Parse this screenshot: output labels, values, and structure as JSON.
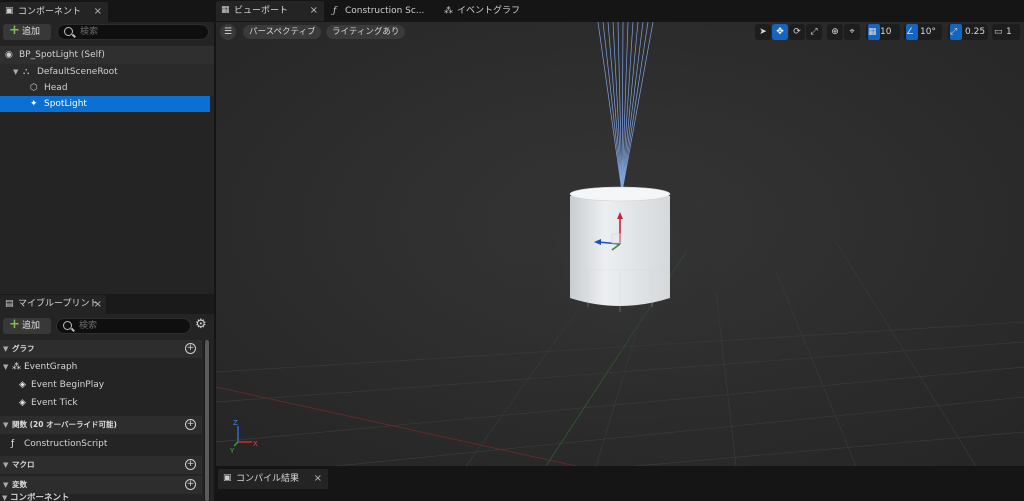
{
  "components_panel": {
    "tab_label": "コンポーネント",
    "add_label": "追加",
    "search_placeholder": "検索",
    "tree": {
      "root": "BP_SpotLight (Self)",
      "scene_root": "DefaultSceneRoot",
      "head": "Head",
      "spotlight": "SpotLight"
    }
  },
  "blueprint_panel": {
    "tab_label": "マイブループリント",
    "add_label": "追加",
    "search_placeholder": "検索",
    "sections": {
      "graph": "グラフ",
      "functions": "関数 (20 オーバーライド可能)",
      "macros": "マクロ",
      "variables": "変数"
    },
    "graph_items": {
      "event_graph": "EventGraph",
      "begin_play": "Event BeginPlay",
      "tick": "Event Tick"
    },
    "function_items": {
      "construction_script": "ConstructionScript"
    },
    "variables_sub": "コンポーネント"
  },
  "main_tabs": {
    "viewport": "ビューポート",
    "construction": "Construction Sc...",
    "event_graph": "イベントグラフ"
  },
  "viewport": {
    "perspective_label": "パースペクティブ",
    "lighting_label": "ライティングあり",
    "grid_snap": "10",
    "rotation_snap": "10°",
    "scale_snap": "0.25",
    "camera_speed": "1",
    "axis_x": "X",
    "axis_y": "Y",
    "axis_z": "Z"
  },
  "compile_panel": {
    "tab_label": "コンパイル結果"
  }
}
